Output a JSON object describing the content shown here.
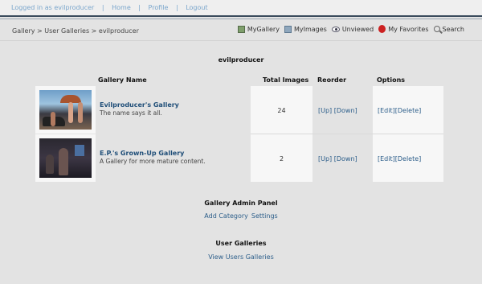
{
  "topbar": {
    "logged_prefix": "Logged in as ",
    "username": "evilproducer",
    "links": [
      "Home",
      "Profile",
      "Logout"
    ]
  },
  "breadcrumb": "Gallery > User Galleries > evilproducer",
  "nav": [
    {
      "label": "MyGallery",
      "icon": "gallery-icon"
    },
    {
      "label": "MyImages",
      "icon": "images-icon"
    },
    {
      "label": "Unviewed",
      "icon": "eye-icon"
    },
    {
      "label": "My Favorites",
      "icon": "favorite-icon"
    },
    {
      "label": "Search",
      "icon": "search-icon"
    }
  ],
  "page_title": "evilproducer",
  "table": {
    "headers": {
      "name": "Gallery Name",
      "total": "Total Images",
      "reorder": "Reorder",
      "options": "Options"
    },
    "rows": [
      {
        "name": "Evilproducer's Gallery",
        "description": "The name says it all.",
        "total": "24",
        "up": "[Up]",
        "down": "[Down]",
        "edit": "[Edit]",
        "delete": "[Delete]"
      },
      {
        "name": "E.P.'s Grown-Up Gallery",
        "description": "A Gallery for more mature content.",
        "total": "2",
        "up": "[Up]",
        "down": "[Down]",
        "edit": "[Edit]",
        "delete": "[Delete]"
      }
    ]
  },
  "admin_panel": {
    "title": "Gallery Admin Panel",
    "add_category": "Add Category",
    "settings": "Settings"
  },
  "user_galleries": {
    "title": "User Galleries",
    "view_link": "View Users Galleries"
  }
}
